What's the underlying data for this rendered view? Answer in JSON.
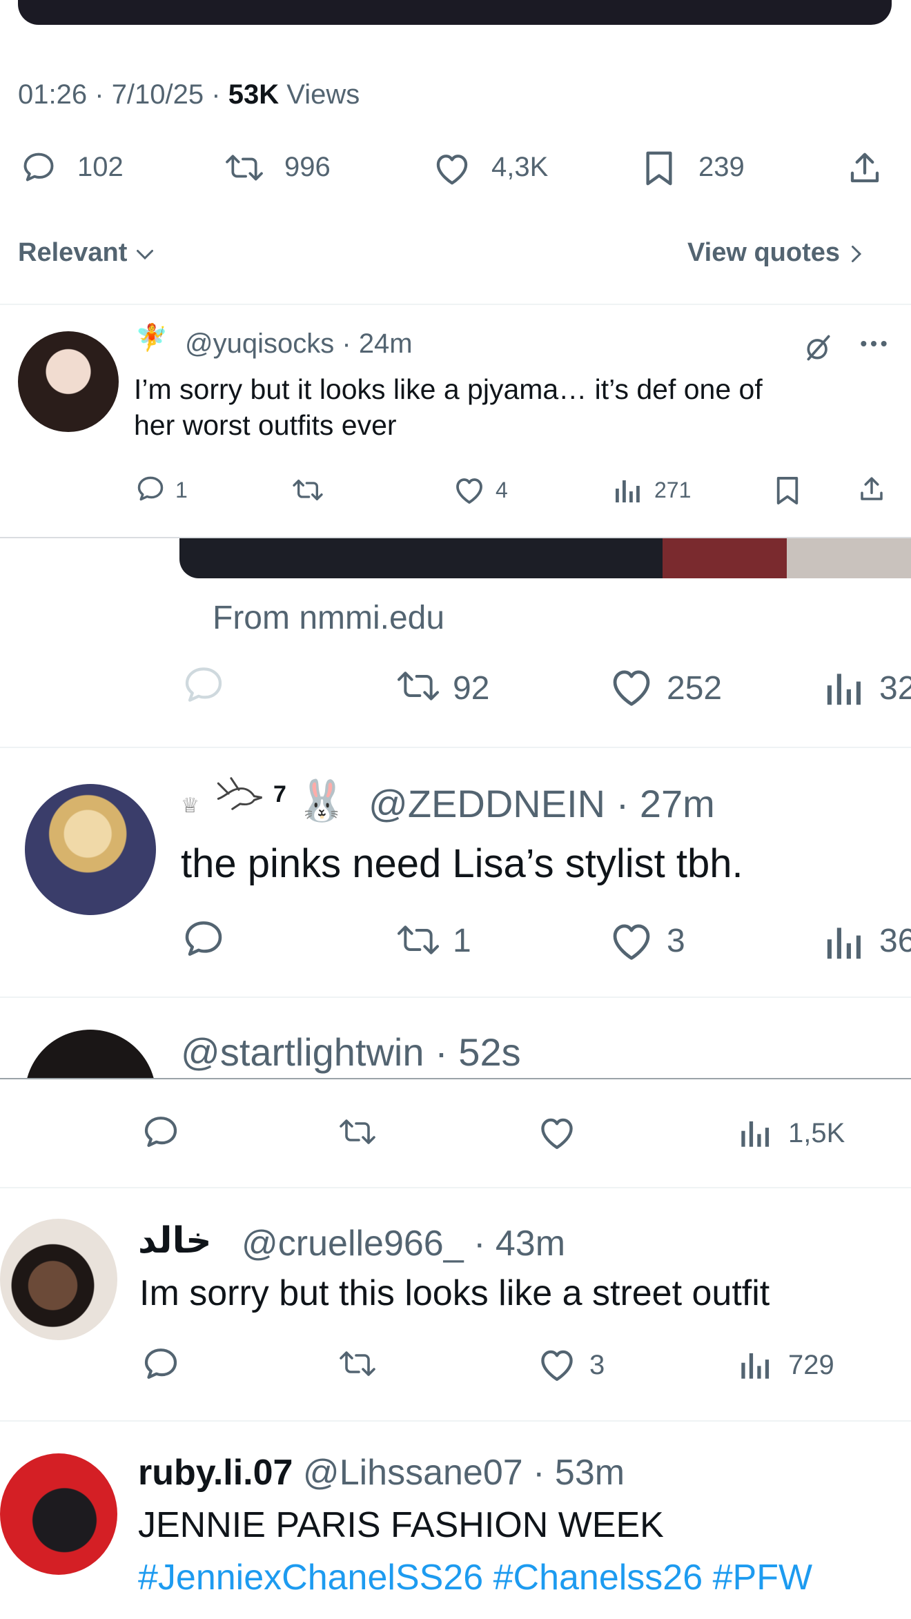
{
  "colors": {
    "accent": "#1d9bf0",
    "muted": "#536471",
    "text": "#0f1419",
    "divider": "#eff3f4"
  },
  "tweet_meta": {
    "time": "01:26",
    "date": "7/10/25",
    "views_count": "53K",
    "views_label": "Views",
    "sep": "·"
  },
  "engagement": {
    "replies": "102",
    "reposts": "996",
    "likes": "4,3K",
    "bookmarks": "239"
  },
  "sort": {
    "label": "Relevant",
    "quotes_label": "View quotes"
  },
  "replies": [
    {
      "badge": "🧚",
      "handle": "@yuqisocks",
      "time": "24m",
      "text_line1": "I’m sorry but it looks like a pjyama… it’s def one of",
      "text_line2": "her worst outfits ever",
      "replies": "1",
      "reposts": "",
      "likes": "4",
      "views": "271"
    },
    {
      "source": "From nmmi.edu",
      "replies": "",
      "reposts": "92",
      "likes": "252",
      "views": "32"
    },
    {
      "badge_num": "7",
      "badge_bunny": "🐰",
      "handle": "@ZEDDNEIN",
      "time": "27m",
      "text": "the pinks need Lisa’s stylist tbh.",
      "replies": "",
      "reposts": "1",
      "likes": "3",
      "views": "36"
    },
    {
      "handle": "@startlightwin",
      "time": "52s",
      "views": "1,5K"
    },
    {
      "display_name": "خالد",
      "handle": "@cruelle966_",
      "time": "43m",
      "text": "Im sorry but this looks like a street outfit",
      "likes": "3",
      "views": "729"
    },
    {
      "display_name": "ruby.li.07",
      "handle": "@Lihssane07",
      "time": "53m",
      "text": "JENNIE PARIS FASHION WEEK",
      "hashtags": "#JenniexChanelSS26 #Chanelss26 #PFW"
    }
  ]
}
